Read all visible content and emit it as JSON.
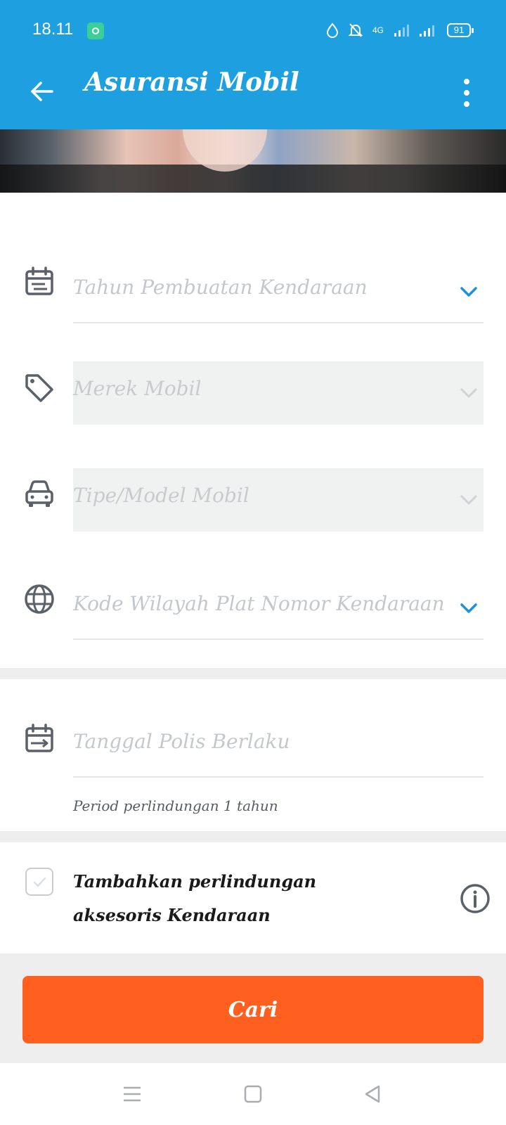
{
  "status_bar": {
    "time": "18.11",
    "network": "4G",
    "battery": "91"
  },
  "app_bar": {
    "title": "Asuransi Mobil"
  },
  "form": {
    "fields": [
      {
        "placeholder": "Tahun Pembuatan Kendaraan",
        "icon": "calendar-icon",
        "enabled": true
      },
      {
        "placeholder": "Merek Mobil",
        "icon": "tag-icon",
        "enabled": false
      },
      {
        "placeholder": "Tipe/Model Mobil",
        "icon": "car-icon",
        "enabled": false
      },
      {
        "placeholder": "Kode Wilayah Plat Nomor Kendaraan",
        "icon": "globe-icon",
        "enabled": true
      }
    ],
    "policy_date": {
      "placeholder": "Tanggal Polis Berlaku",
      "icon": "calendar-arrow-icon",
      "helper": "Period perlindungan 1 tahun"
    }
  },
  "addon": {
    "label": "Tambahkan perlindungan aksesoris Kendaraan",
    "checked": false
  },
  "actions": {
    "search_label": "Cari"
  },
  "colors": {
    "primary": "#1ea0e0",
    "accent": "#ff5f1f",
    "chevron_active": "#1e90e0",
    "chevron_disabled": "#cfd3d6"
  }
}
